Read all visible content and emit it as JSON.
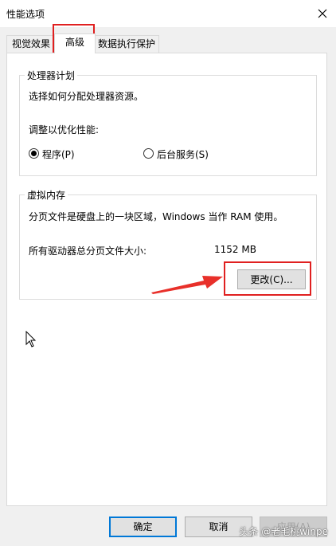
{
  "window": {
    "title": "性能选项"
  },
  "tabs": [
    {
      "label": "视觉效果"
    },
    {
      "label": "高级"
    },
    {
      "label": "数据执行保护"
    }
  ],
  "processor": {
    "legend": "处理器计划",
    "description": "选择如何分配处理器资源。",
    "adjust_label": "调整以优化性能:",
    "options": [
      {
        "label": "程序(P)",
        "selected": true
      },
      {
        "label": "后台服务(S)",
        "selected": false
      }
    ]
  },
  "virtual_memory": {
    "legend": "虚拟内存",
    "description": "分页文件是硬盘上的一块区域，Windows 当作 RAM 使用。",
    "total_label": "所有驱动器总分页文件大小:",
    "total_value": "1152 MB",
    "change_button": "更改(C)..."
  },
  "footer": {
    "ok": "确定",
    "cancel": "取消",
    "apply": "应用(A)"
  },
  "watermark": "头条 @老毛桃winpe",
  "colors": {
    "highlight": "#e02020",
    "accent": "#0078d7"
  }
}
